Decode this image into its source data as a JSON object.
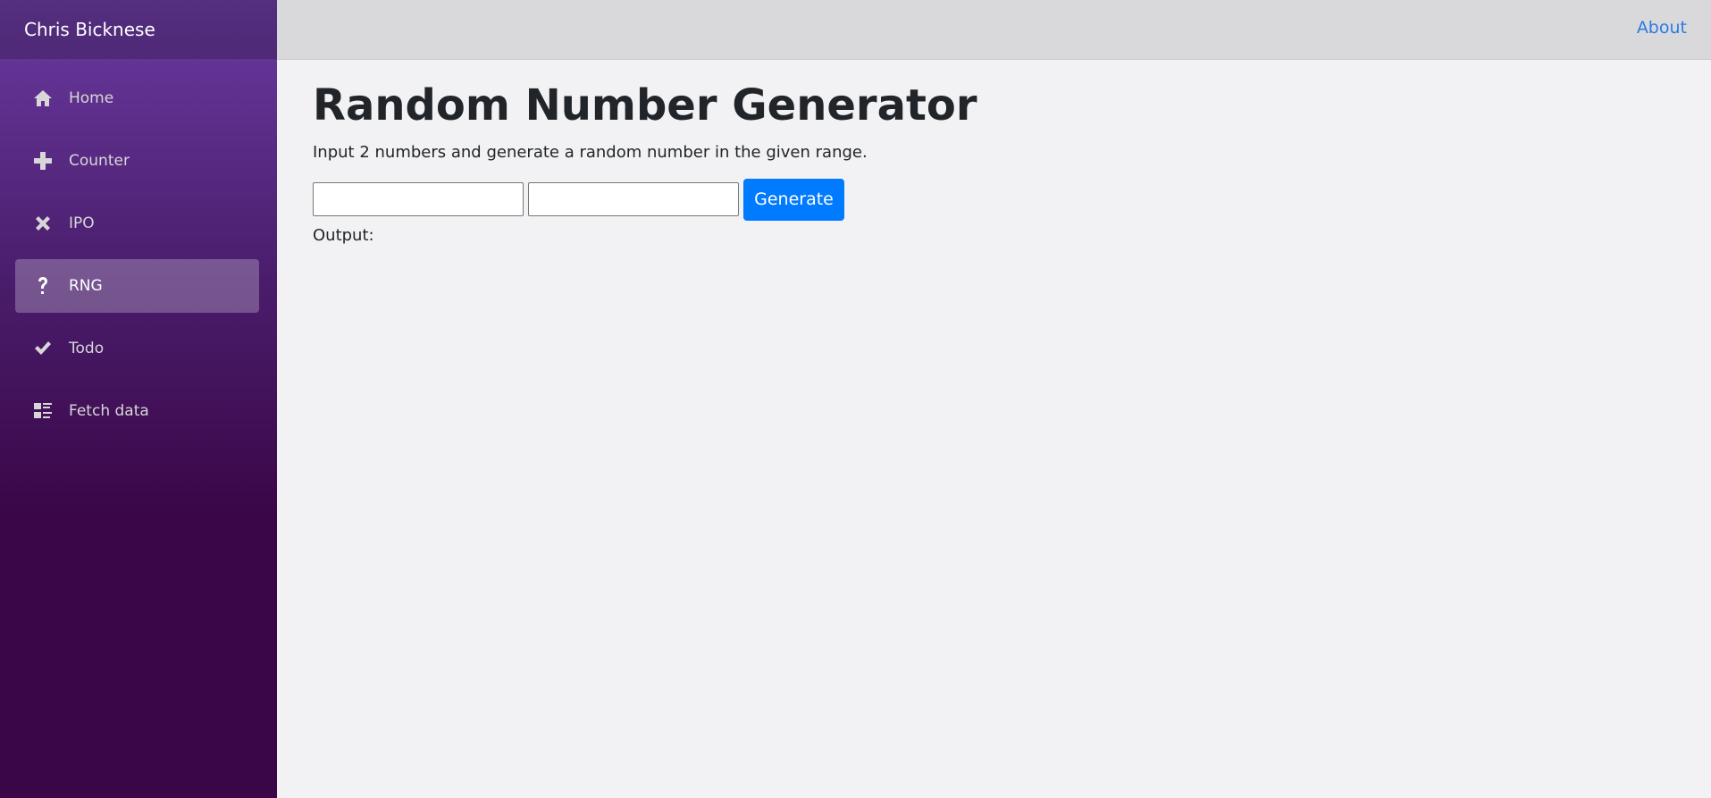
{
  "sidebar": {
    "brand": "Chris Bicknese",
    "items": [
      {
        "label": "Home",
        "icon": "home-icon",
        "active": false
      },
      {
        "label": "Counter",
        "icon": "plus-icon",
        "active": false
      },
      {
        "label": "IPO",
        "icon": "x-icon",
        "active": false
      },
      {
        "label": "RNG",
        "icon": "question-icon",
        "active": true
      },
      {
        "label": "Todo",
        "icon": "check-icon",
        "active": false
      },
      {
        "label": "Fetch data",
        "icon": "list-rich-icon",
        "active": false
      }
    ]
  },
  "topbar": {
    "about_label": "About"
  },
  "main": {
    "title": "Random Number Generator",
    "description": "Input 2 numbers and generate a random number in the given range.",
    "input_min": {
      "value": "",
      "placeholder": ""
    },
    "input_max": {
      "value": "",
      "placeholder": ""
    },
    "generate_label": "Generate",
    "output_label": "Output:"
  },
  "colors": {
    "accent": "#007bff",
    "link": "#2a7be4",
    "sidebar_top": "#6a3aa0",
    "sidebar_bottom": "#3a0647"
  }
}
